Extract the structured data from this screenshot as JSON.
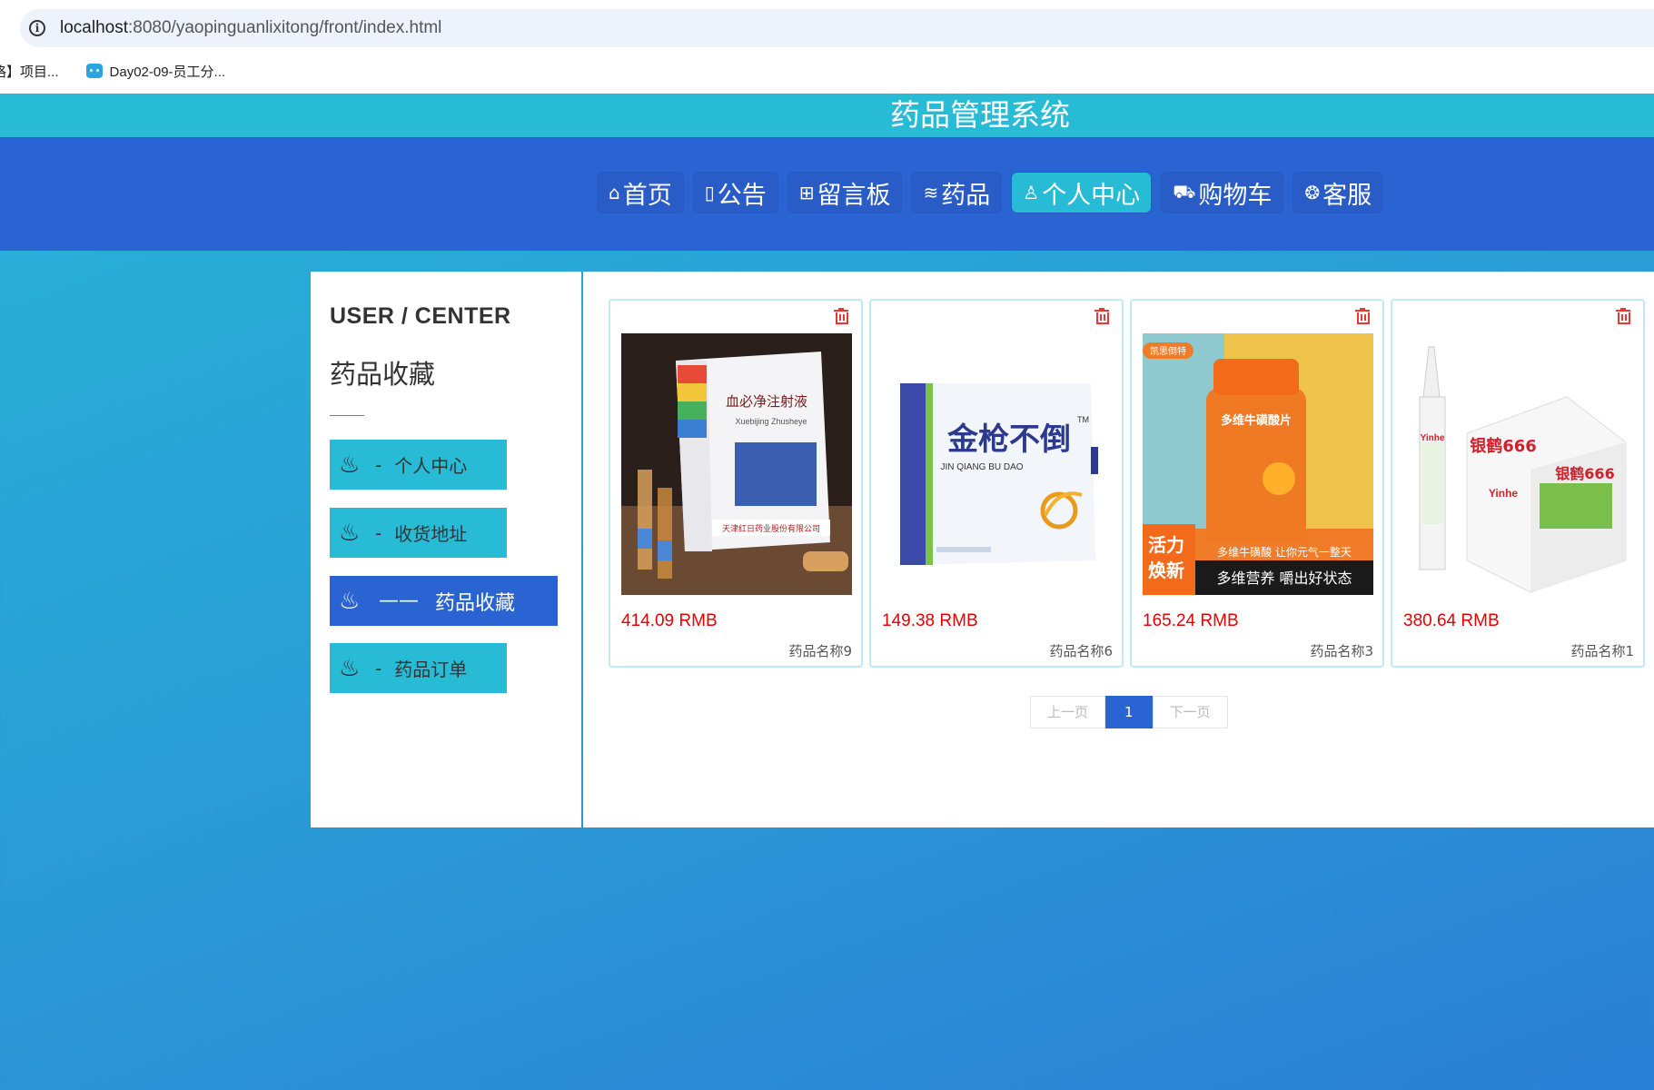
{
  "browser": {
    "url_host": "localhost",
    "url_rest": ":8080/yaopinguanlixitong/front/index.html",
    "bookmarks": [
      {
        "label": "咯】项目..."
      },
      {
        "label": "Day02-09-员工分..."
      }
    ]
  },
  "site": {
    "title": "药品管理系统"
  },
  "nav": {
    "items": [
      {
        "label": "首页",
        "icon": "home-icon"
      },
      {
        "label": "公告",
        "icon": "note-icon"
      },
      {
        "label": "留言板",
        "icon": "gift-icon"
      },
      {
        "label": "药品",
        "icon": "layers-icon"
      },
      {
        "label": "个人中心",
        "icon": "user-icon",
        "active": true
      },
      {
        "label": "购物车",
        "icon": "cart-icon"
      },
      {
        "label": "客服",
        "icon": "wechat-icon"
      }
    ]
  },
  "sidebar": {
    "title": "USER / CENTER",
    "subtitle": "药品收藏",
    "items": [
      {
        "label": "个人中心",
        "dash": "-"
      },
      {
        "label": "收货地址",
        "dash": "-"
      },
      {
        "label": "药品收藏",
        "dash": "——",
        "active": true
      },
      {
        "label": "药品订单",
        "dash": "-"
      }
    ]
  },
  "products": [
    {
      "price": "414.09 RMB",
      "name": "药品名称9"
    },
    {
      "price": "149.38 RMB",
      "name": "药品名称6"
    },
    {
      "price": "165.24 RMB",
      "name": "药品名称3"
    },
    {
      "price": "380.64 RMB",
      "name": "药品名称1"
    }
  ],
  "product_image_text": {
    "p1": {
      "box": "血必净注射液",
      "pinyin": "Xuebijing Zhusheye",
      "maker": "天津红日药业股份有限公司"
    },
    "p2": {
      "brand": "金枪不倒",
      "pinyin": "JIN QIANG BU DAO",
      "tm": "TM"
    },
    "p3": {
      "tag": "凯思倒特",
      "label": "多维牛磺酸片",
      "slogan1": "活力",
      "slogan2": "焕新",
      "line1": "多维牛磺酸 让你元气一整天",
      "line2": "多维营养 嚼出好状态"
    },
    "p4": {
      "brand": "银鹤666",
      "sub": "Yinhe"
    }
  },
  "pager": {
    "prev": "上一页",
    "current": "1",
    "next": "下一页"
  },
  "colors": {
    "accent_cyan": "#27bbd6",
    "accent_blue": "#2a63d2",
    "price_red": "#e60000"
  }
}
